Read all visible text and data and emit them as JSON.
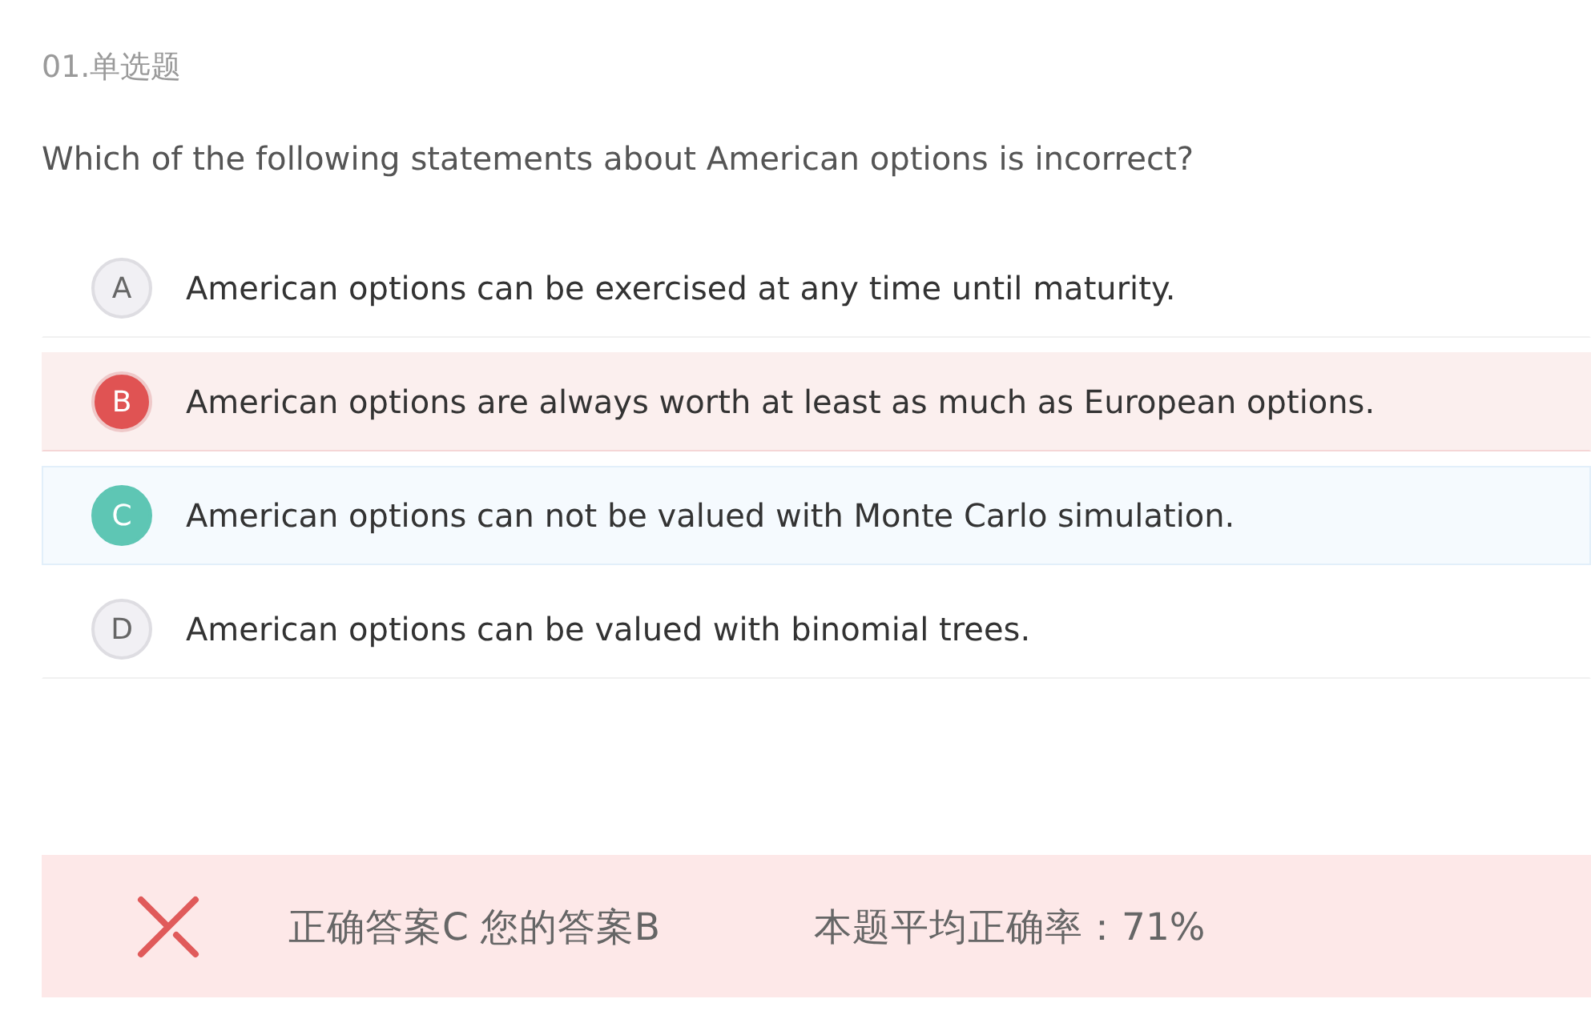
{
  "question": {
    "heading": "01.单选题",
    "text": "Which of the following statements about American options is incorrect?"
  },
  "options": [
    {
      "letter": "A",
      "text": "American options can be exercised at any time until maturity.",
      "selected": false,
      "correct": false
    },
    {
      "letter": "B",
      "text": "American options are always worth at least as much as European options.",
      "selected": true,
      "correct": false
    },
    {
      "letter": "C",
      "text": "American options can not be valued with Monte Carlo simulation.",
      "selected": false,
      "correct": true
    },
    {
      "letter": "D",
      "text": "American options can be valued with binomial trees.",
      "selected": false,
      "correct": false
    }
  ],
  "result": {
    "kind": "wrong",
    "answers": "正确答案C 您的答案B",
    "accuracy": "本题平均正确率：71%"
  }
}
